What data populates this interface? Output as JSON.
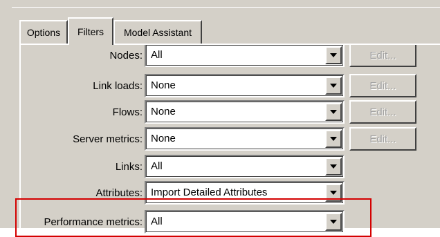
{
  "colors": {
    "dialog_face": "#d4d0c8",
    "field_background": "#ffffff",
    "disabled_text": "#a0a0a0",
    "highlight_border": "#d40000"
  },
  "tabs": [
    {
      "label": "Options",
      "active": false
    },
    {
      "label": "Filters",
      "active": true
    },
    {
      "label": "Model Assistant",
      "active": false
    }
  ],
  "filters": {
    "rows": [
      {
        "label": "Nodes:",
        "value": "All",
        "edit_label": "Edit...",
        "edit_enabled": false
      },
      {
        "label": "Link loads:",
        "value": "None",
        "edit_label": "Edit...",
        "edit_enabled": false
      },
      {
        "label": "Flows:",
        "value": "None",
        "edit_label": "Edit...",
        "edit_enabled": false
      },
      {
        "label": "Server metrics:",
        "value": "None",
        "edit_label": "Edit...",
        "edit_enabled": false
      },
      {
        "label": "Links:",
        "value": "All"
      },
      {
        "label": "Attributes:",
        "value": "Import Detailed Attributes"
      },
      {
        "label": "Performance metrics:",
        "value": "All"
      }
    ]
  },
  "icons": {
    "dropdown": "dropdown-arrow-icon"
  },
  "annotation": {
    "highlighted_row": "Performance metrics:"
  }
}
